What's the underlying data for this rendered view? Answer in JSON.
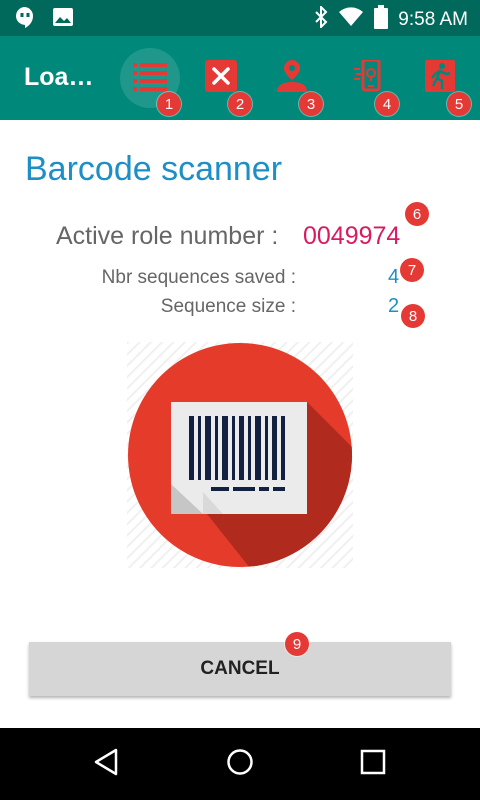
{
  "status_bar": {
    "time": "9:58 AM",
    "icons": [
      "hangouts-icon",
      "image-icon",
      "bluetooth-icon",
      "wifi-icon",
      "battery-icon"
    ]
  },
  "toolbar": {
    "title": "Loa…",
    "actions": [
      {
        "icon": "list-icon",
        "badge": "1",
        "active": true
      },
      {
        "icon": "close-box-icon",
        "badge": "2"
      },
      {
        "icon": "user-location-icon",
        "badge": "3"
      },
      {
        "icon": "phone-signal-icon",
        "badge": "4"
      },
      {
        "icon": "exit-icon",
        "badge": "5"
      }
    ]
  },
  "main": {
    "heading": "Barcode scanner",
    "role_label": "Active role number :",
    "role_value": "0049974",
    "role_badge": "6",
    "seq_saved_label": "Nbr sequences saved :",
    "seq_saved_value": "4",
    "seq_saved_badge": "7",
    "seq_size_label": "Sequence size :",
    "seq_size_value": "2",
    "seq_size_badge": "8",
    "cancel_label": "CANCEL",
    "cancel_badge": "9"
  },
  "colors": {
    "status_bar": "#00695c",
    "toolbar": "#00897b",
    "icon_red": "#e53935",
    "heading": "#1e8fc6",
    "role_value": "#d81b60"
  }
}
